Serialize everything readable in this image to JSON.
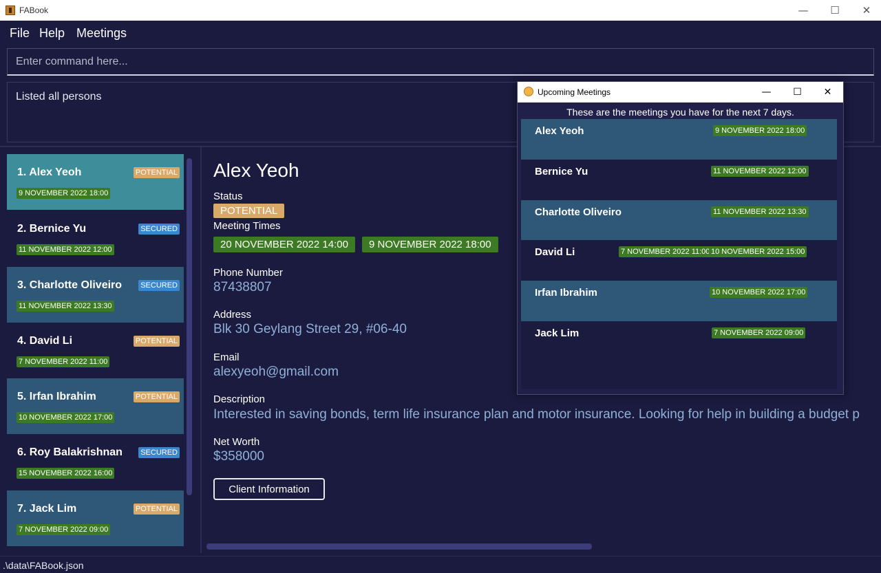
{
  "window": {
    "title": "FABook"
  },
  "menu": [
    "File",
    "Help",
    "Meetings"
  ],
  "command": {
    "placeholder": "Enter command here..."
  },
  "result": {
    "message": "Listed all persons"
  },
  "persons": [
    {
      "name": "1.  Alex Yeoh",
      "status": "POTENTIAL",
      "meeting": "9 NOVEMBER 2022 18:00"
    },
    {
      "name": "2.  Bernice Yu",
      "status": "SECURED",
      "meeting": "11 NOVEMBER 2022 12:00"
    },
    {
      "name": "3.  Charlotte Oliveiro",
      "status": "SECURED",
      "meeting": "11 NOVEMBER 2022 13:30"
    },
    {
      "name": "4.  David Li",
      "status": "POTENTIAL",
      "meeting": "7 NOVEMBER 2022 11:00"
    },
    {
      "name": "5.  Irfan Ibrahim",
      "status": "POTENTIAL",
      "meeting": "10 NOVEMBER 2022 17:00"
    },
    {
      "name": "6.  Roy Balakrishnan",
      "status": "SECURED",
      "meeting": "15 NOVEMBER 2022 16:00"
    },
    {
      "name": "7.  Jack Lim",
      "status": "POTENTIAL",
      "meeting": "7 NOVEMBER 2022 09:00"
    }
  ],
  "details": {
    "name": "Alex Yeoh",
    "status_label": "Status",
    "status": "POTENTIAL",
    "meeting_label": "Meeting Times",
    "meetings": [
      "20 NOVEMBER 2022 14:00",
      "9 NOVEMBER 2022 18:00"
    ],
    "phone_label": "Phone Number",
    "phone": "87438807",
    "address_label": "Address",
    "address": "Blk 30 Geylang Street 29, #06-40",
    "email_label": "Email",
    "email": "alexyeoh@gmail.com",
    "description_label": "Description",
    "description": "Interested in saving bonds, term life insurance plan and motor insurance. Looking for help in building a budget p",
    "networth_label": "Net Worth",
    "networth": "$358000",
    "client_button": "Client Information"
  },
  "statusbar": {
    "path": ".\\data\\FABook.json"
  },
  "popup": {
    "title": "Upcoming Meetings",
    "subtitle": "These are the meetings you have for the next 7 days.",
    "rows": [
      {
        "name": "Alex Yeoh",
        "meetings": [
          "9 NOVEMBER 2022 18:00"
        ]
      },
      {
        "name": "Bernice Yu",
        "meetings": [
          "11 NOVEMBER 2022 12:00"
        ]
      },
      {
        "name": "Charlotte Oliveiro",
        "meetings": [
          "11 NOVEMBER 2022 13:30"
        ]
      },
      {
        "name": "David Li",
        "meetings": [
          "7 NOVEMBER 2022 11:00",
          "10 NOVEMBER 2022 15:00"
        ]
      },
      {
        "name": "Irfan Ibrahim",
        "meetings": [
          "10 NOVEMBER 2022 17:00"
        ]
      },
      {
        "name": "Jack Lim",
        "meetings": [
          "7 NOVEMBER 2022 09:00"
        ]
      }
    ]
  }
}
